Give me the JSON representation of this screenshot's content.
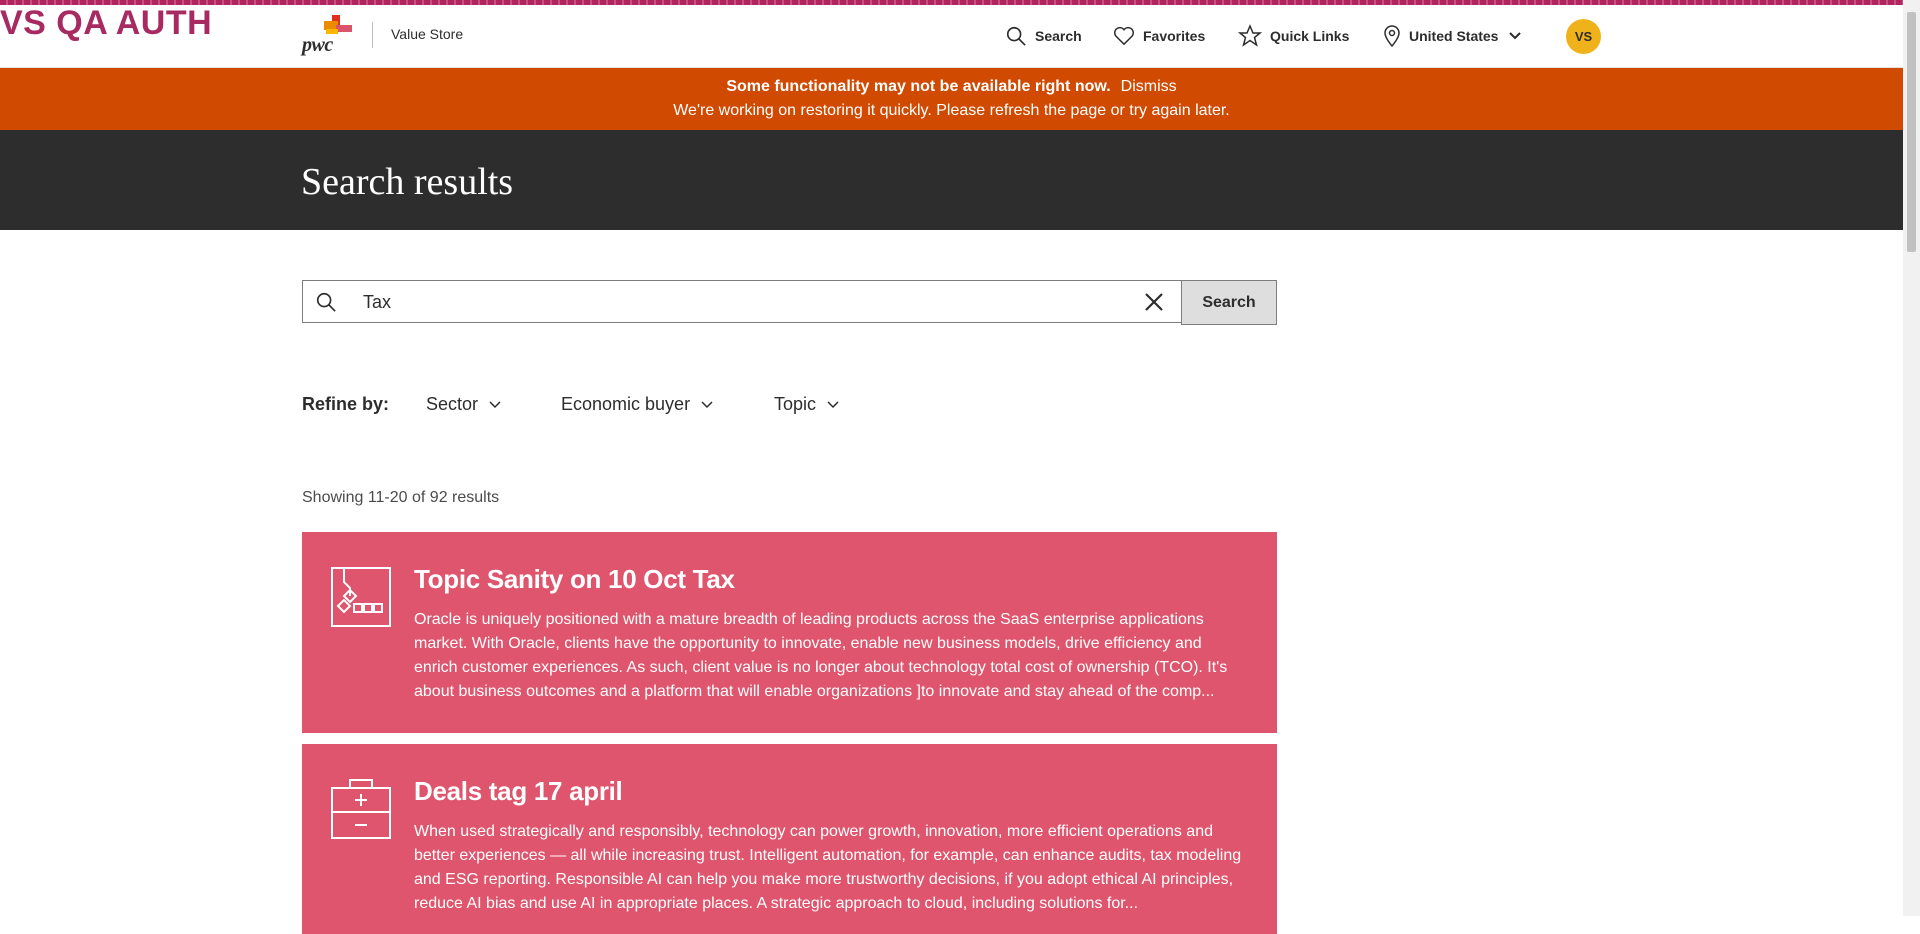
{
  "env_label": "VS QA AUTH",
  "header": {
    "logo_text": "pwc",
    "app_name": "Value Store",
    "nav": {
      "search": "Search",
      "favorites": "Favorites",
      "quick_links": "Quick Links",
      "country": "United States"
    },
    "avatar_initials": "VS"
  },
  "alert": {
    "title": "Some functionality may not be available right now.",
    "dismiss": "Dismiss",
    "message": "We're working on restoring it quickly. Please refresh the page or try again later."
  },
  "hero": {
    "title": "Search results"
  },
  "search": {
    "value": "Tax",
    "button_label": "Search"
  },
  "refine": {
    "label": "Refine by:",
    "filters": [
      "Sector",
      "Economic buyer",
      "Topic"
    ]
  },
  "results": {
    "summary": "Showing 11-20 of 92 results",
    "items": [
      {
        "title": "Topic Sanity on 10 Oct Tax",
        "description": "Oracle is uniquely positioned with a mature breadth of leading products across the SaaS enterprise applications market. With Oracle, clients have the opportunity to innovate, enable new business models, drive efficiency and enrich customer experiences. As such, client value is no longer about technology total cost of ownership (TCO). It's about business outcomes and a platform that will enable organizations ]to innovate and stay ahead of the comp...",
        "icon": "flowchart-icon"
      },
      {
        "title": "Deals tag 17 april",
        "description": "When used strategically and responsibly, technology can power growth, innovation, more efficient operations and better experiences — all while increasing trust. Intelligent automation, for example, can enhance audits, tax modeling and ESG reporting. Responsible AI can help you make more trustworthy decisions, if you adopt ethical AI principles, reduce AI bias and use AI in appropriate places. A strategic approach to cloud, including solutions for...",
        "icon": "medical-kit-icon"
      }
    ]
  },
  "colors": {
    "accent": "#d04a02",
    "card": "#de556d",
    "hero": "#2d2d2d",
    "avatar": "#f0b21a",
    "env_label": "#a72a61"
  }
}
